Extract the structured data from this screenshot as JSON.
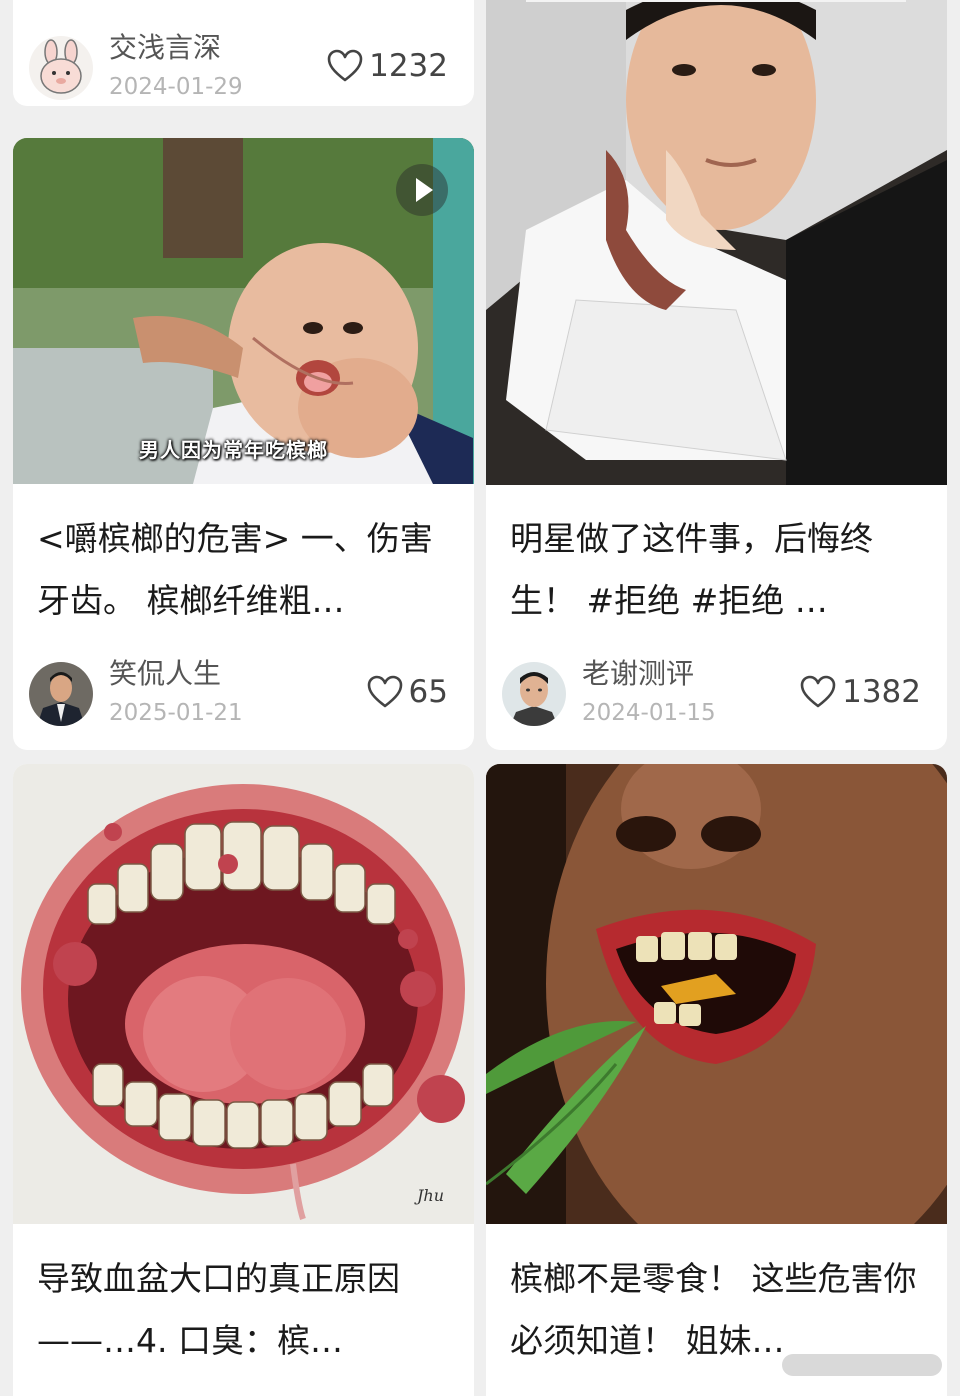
{
  "feed": {
    "cards": [
      {
        "author": "交浅言深",
        "date": "2024-01-29",
        "likes": "1232"
      },
      {
        "title": "<嚼槟榔的危害> 一、伤害牙齿。 槟榔纤维粗…",
        "author": "笑侃人生",
        "date": "2025-01-21",
        "likes": "65",
        "thumbnail_caption": "男人因为常年吃槟榔",
        "is_video": true
      },
      {
        "title": "明星做了这件事，后悔终生！ #拒绝 #拒绝 …",
        "author": "老谢测评",
        "date": "2024-01-15",
        "likes": "1382"
      },
      {
        "title": "导致血盆大口的真正原因——…4. 口臭：槟…",
        "thumbnail_signature": "Jhu"
      },
      {
        "title": "槟榔不是零食！ 这些危害你必须知道！ 姐妹…"
      }
    ]
  },
  "icons": {
    "like": "heart-outline-icon",
    "play": "play-icon"
  },
  "colors": {
    "background": "#efefef",
    "card": "#ffffff",
    "text": "#1a1a1a",
    "muted": "#b5b5b5"
  }
}
